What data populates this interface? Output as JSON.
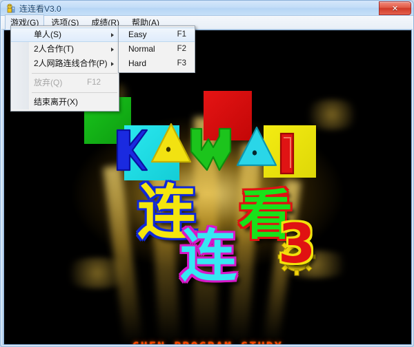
{
  "window": {
    "title": "连连看V3.0",
    "app_icon": "game-app-icon",
    "close_label": "✕",
    "close_icon": "close-icon"
  },
  "menubar": {
    "items": [
      {
        "label": "游戏(G)",
        "name": "menu-game",
        "open": true
      },
      {
        "label": "选项(S)",
        "name": "menu-options",
        "open": false
      },
      {
        "label": "成绩(R)",
        "name": "menu-scores",
        "open": false
      },
      {
        "label": "帮助(A)",
        "name": "menu-help",
        "open": false
      }
    ]
  },
  "game_menu": {
    "items": [
      {
        "label": "单人(S)",
        "accel": "",
        "submenu": true,
        "disabled": false,
        "highlighted": true
      },
      {
        "label": "2人合作(T)",
        "accel": "",
        "submenu": true,
        "disabled": false,
        "highlighted": false
      },
      {
        "label": "2人网路连线合作(P)",
        "accel": "",
        "submenu": true,
        "disabled": false,
        "highlighted": false
      },
      {
        "separator": true
      },
      {
        "label": "放弃(Q)",
        "accel": "F12",
        "submenu": false,
        "disabled": true,
        "highlighted": false
      },
      {
        "separator": true
      },
      {
        "label": "结束离开(X)",
        "accel": "",
        "submenu": false,
        "disabled": false,
        "highlighted": false
      }
    ]
  },
  "difficulty_menu": {
    "items": [
      {
        "label": "Easy",
        "accel": "F1",
        "highlighted": true
      },
      {
        "label": "Normal",
        "accel": "F2",
        "highlighted": false
      },
      {
        "label": "Hard",
        "accel": "F3",
        "highlighted": false
      }
    ]
  },
  "splash": {
    "title_letters": [
      "K",
      "A",
      "W",
      "A",
      "I"
    ],
    "chinese_1": "连",
    "chinese_2": "连",
    "chinese_3": "看",
    "version_number": "3",
    "studio_text": "CHEN PROGRAM STUDY"
  },
  "colors": {
    "titlebar": "#c2dcf7",
    "close_button": "#cf3a28",
    "green": "#19c41c",
    "cyan": "#2ae8ef",
    "red": "#e51414",
    "yellow": "#f4ec12",
    "blue": "#1028d8",
    "magenta": "#d718c8",
    "studio_orange": "#ff4500",
    "glow": "#ffe178"
  }
}
